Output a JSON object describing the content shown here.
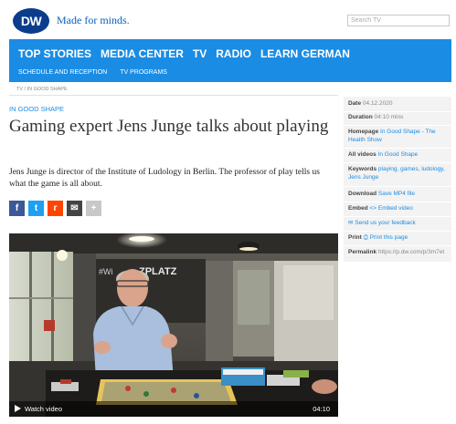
{
  "header": {
    "logo_text": "DW",
    "tagline": "Made for minds.",
    "search_placeholder": "Search TV"
  },
  "nav": {
    "main": [
      "TOP STORIES",
      "MEDIA CENTER",
      "TV",
      "RADIO",
      "LEARN GERMAN"
    ],
    "active": "TV",
    "sub": [
      "SCHEDULE AND RECEPTION",
      "TV PROGRAMS"
    ]
  },
  "breadcrumb": "TV / IN GOOD SHAPE",
  "article": {
    "category": "IN GOOD SHAPE",
    "title": "Gaming expert Jens Junge talks about playing",
    "teaser": "Jens Junge is director of the Institute of Ludology in Berlin. The professor of play tells us what the game is all about."
  },
  "share": {
    "icons": [
      "facebook-icon",
      "twitter-icon",
      "reddit-icon",
      "email-icon",
      "more-icon"
    ],
    "labels": [
      "f",
      "t",
      "r",
      "✉",
      "+"
    ]
  },
  "video": {
    "watch_label": "Watch video",
    "duration": "04:10"
  },
  "sidebar": {
    "date_label": "Date",
    "date_value": "04.12.2020",
    "duration_label": "Duration",
    "duration_value": "04:10 mins",
    "homepage_label": "Homepage",
    "homepage_value": "In Good Shape - The Health Show",
    "allvideos_label": "All videos",
    "allvideos_value": "In Good Shape",
    "keywords_label": "Keywords",
    "keywords_value": "playing, games, ludology, Jens Junge",
    "download_label": "Download",
    "download_value": "Save MP4 file",
    "embed_label": "Embed",
    "embed_value": "<> Embed video",
    "feedback_value": "Send us your feedback",
    "print_label": "Print",
    "print_value": "Print this page",
    "permalink_label": "Permalink",
    "permalink_value": "https://p.dw.com/p/3m7et"
  },
  "colors": {
    "brand_blue": "#1a8ce4",
    "logo_blue": "#0a3d8c",
    "facebook": "#3b5998",
    "twitter": "#1da1f2",
    "reddit": "#ff4500",
    "email": "#444444",
    "more": "#c8c8c8"
  }
}
